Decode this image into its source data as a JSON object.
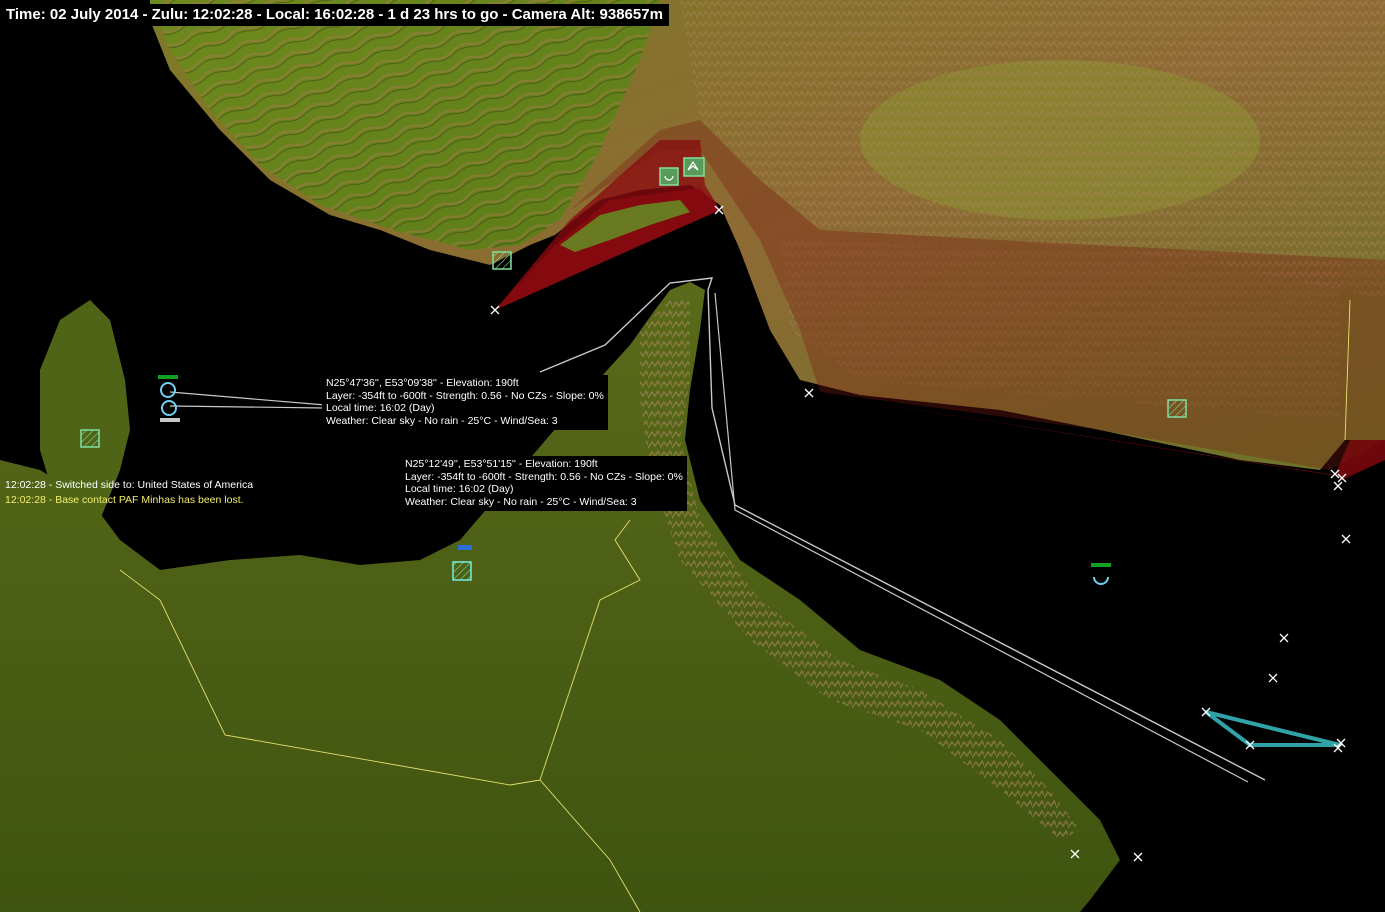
{
  "status_bar": {
    "text": "Time: 02 July 2014 - Zulu: 12:02:28 - Local: 16:02:28 - 1 d 23 hrs to go -  Camera Alt: 938657m"
  },
  "tooltips": [
    {
      "lines": [
        "N25°47'36'', E53°09'38'' - Elevation: 190ft",
        "Layer: -354ft to -600ft - Strength: 0.56 - No CZs - Slope: 0%",
        "Local time: 16:02 (Day)",
        "Weather: Clear sky - No rain - 25°C - Wind/Sea: 3"
      ]
    },
    {
      "lines": [
        "N25°12'49'', E53°51'15'' - Elevation: 190ft",
        "Layer: -354ft to -600ft - Strength: 0.56 - No CZs - Slope: 0%",
        "Local time: 16:02 (Day)",
        "Weather: Clear sky - No rain - 25°C - Wind/Sea: 3"
      ]
    }
  ],
  "message_log": [
    {
      "text": "12:02:28 - Switched side to: United States of America",
      "color": "#ffffff"
    },
    {
      "text": "12:02:28 - Base contact PAF Minhas has been lost.",
      "color": "#f2ee6a"
    }
  ],
  "map_markers": {
    "facility_icon": "hatched-square-facility-icon",
    "unit_icon": "circle-unit-icon",
    "waypoint_icon": "x-waypoint-icon",
    "colors": {
      "friendly_facility": "#7fe0a0",
      "unit_ring": "#6fd0f0",
      "exclusion_zone": "#8a0a10",
      "patrol_route": "#2fa3a8",
      "plotted_course": "#c8c8c8",
      "border": "#e6e070"
    }
  }
}
